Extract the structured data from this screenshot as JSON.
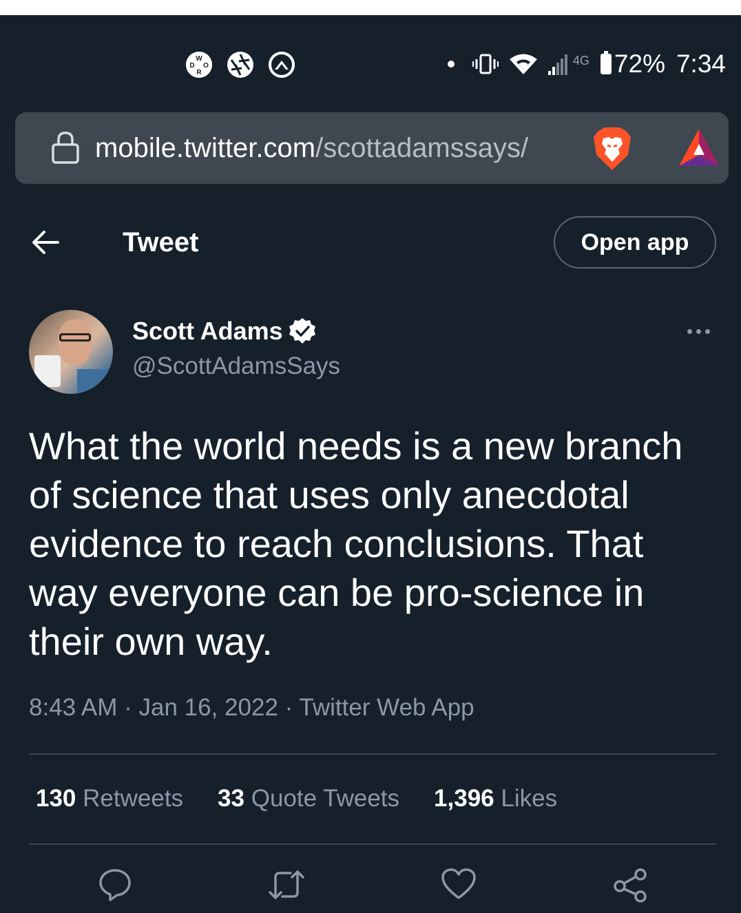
{
  "status_bar": {
    "app_icons": [
      "wdor-icon",
      "aperture-icon",
      "mountain-icon"
    ],
    "network_label": "4G",
    "battery": "72%",
    "time": "7:34"
  },
  "browser": {
    "url_host": "mobile.twitter.com",
    "url_path": "/scottadamssays/"
  },
  "header": {
    "title": "Tweet",
    "open_app": "Open app"
  },
  "tweet": {
    "author_name": "Scott Adams",
    "handle": "@ScottAdamsSays",
    "verified": true,
    "text": "What the world needs is a new branch of science that uses only anecdotal evidence to reach conclusions. That way everyone can be pro-science in their own way.",
    "meta": "8:43 AM · Jan 16, 2022 · Twitter Web App"
  },
  "stats": {
    "retweets_count": "130",
    "retweets_label": "Retweets",
    "quotes_count": "33",
    "quotes_label": "Quote Tweets",
    "likes_count": "1,396",
    "likes_label": "Likes"
  },
  "colors": {
    "background": "#15202b",
    "muted_text": "#8b98a5",
    "divider": "#38444d",
    "urlbar": "#3f4750"
  }
}
